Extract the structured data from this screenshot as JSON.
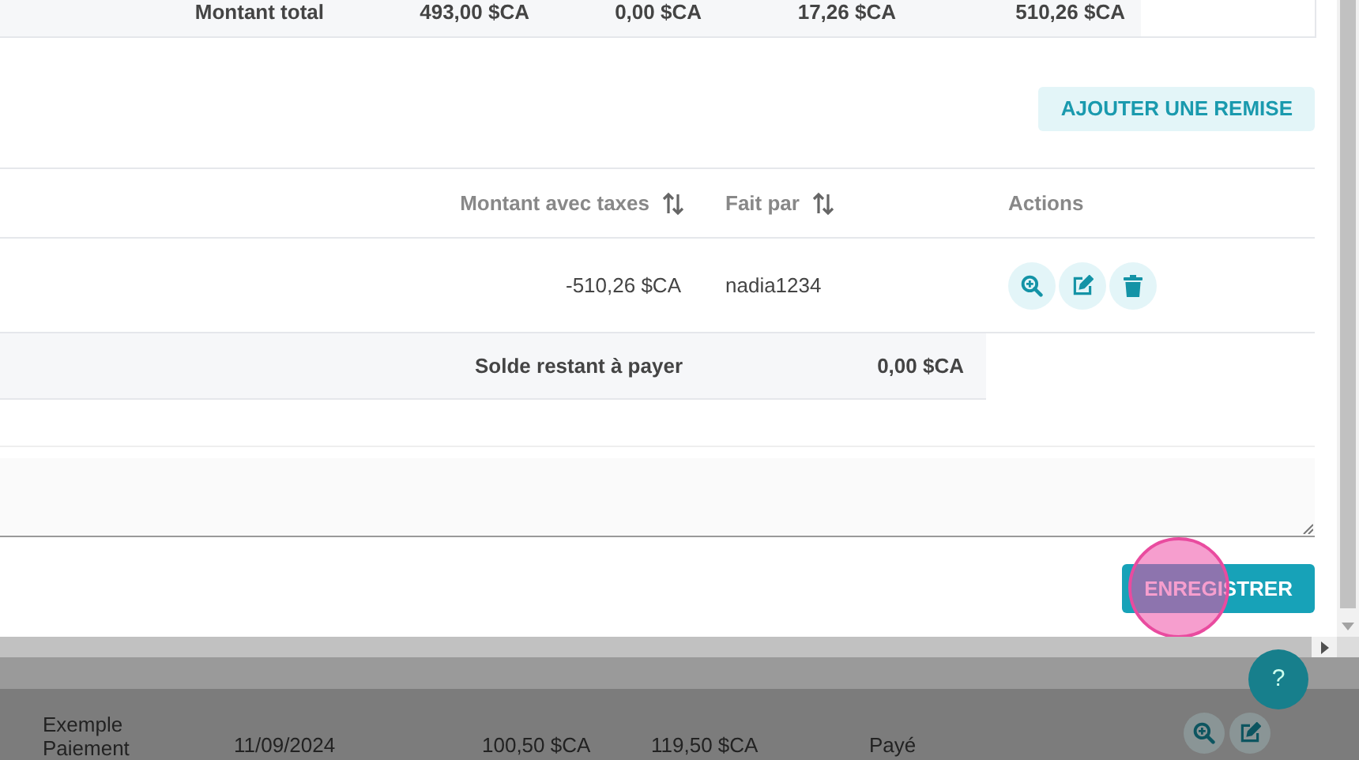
{
  "totals_row": {
    "label": "Montant total",
    "values": [
      "493,00 $CA",
      "0,00 $CA",
      "17,26 $CA",
      "510,26 $CA"
    ]
  },
  "add_discount_button": "AJOUTER UNE REMISE",
  "payments_table": {
    "columns": [
      {
        "label": "Montant avec taxes",
        "sortable": true
      },
      {
        "label": "Fait par",
        "sortable": true
      },
      {
        "label": "Actions",
        "sortable": false
      }
    ],
    "rows": [
      {
        "amount": "-510,26 $CA",
        "made_by": "nadia1234"
      }
    ],
    "balance": {
      "label": "Solde restant à payer",
      "value": "0,00 $CA"
    }
  },
  "save_button": "ENREGISTRER",
  "background_table": {
    "rows": [
      {
        "cells": [
          "Exemple Paiement",
          "11/09/2024",
          "100,50 $CA",
          "119,50 $CA",
          "Payé"
        ]
      }
    ]
  },
  "help_button": "?"
}
